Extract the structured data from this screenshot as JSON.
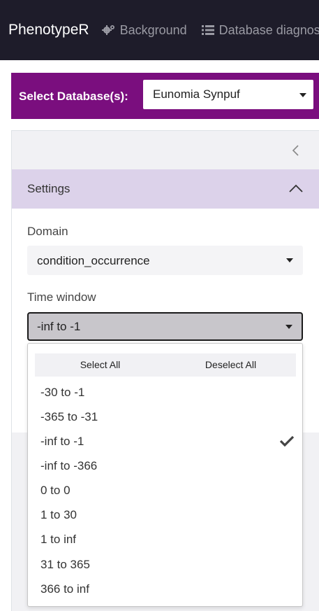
{
  "navbar": {
    "brand": "PhenotypeR",
    "links": [
      {
        "label": "Background",
        "icon": "gears-icon"
      },
      {
        "label": "Database diagnostics",
        "icon": "list-icon"
      }
    ]
  },
  "database_bar": {
    "label": "Select Database(s):",
    "selected": "Eunomia Synpuf"
  },
  "sidebar": {
    "settings": {
      "title": "Settings",
      "domain_label": "Domain",
      "domain_value": "condition_occurrence",
      "time_window_label": "Time window",
      "time_window_value": "-inf to -1",
      "dropdown": {
        "select_all": "Select All",
        "deselect_all": "Deselect All",
        "options": [
          {
            "label": "-30 to -1",
            "selected": false
          },
          {
            "label": "-365 to -31",
            "selected": false
          },
          {
            "label": "-inf to -1",
            "selected": true
          },
          {
            "label": "-inf to -366",
            "selected": false
          },
          {
            "label": "0 to 0",
            "selected": false
          },
          {
            "label": "1 to 30",
            "selected": false
          },
          {
            "label": "1 to inf",
            "selected": false
          },
          {
            "label": "31 to 365",
            "selected": false
          },
          {
            "label": "366 to inf",
            "selected": false
          }
        ]
      }
    }
  },
  "colors": {
    "navbar": "#1e1c2a",
    "database_bar": "#7a0e7e",
    "settings_header": "#dcd2ea"
  }
}
